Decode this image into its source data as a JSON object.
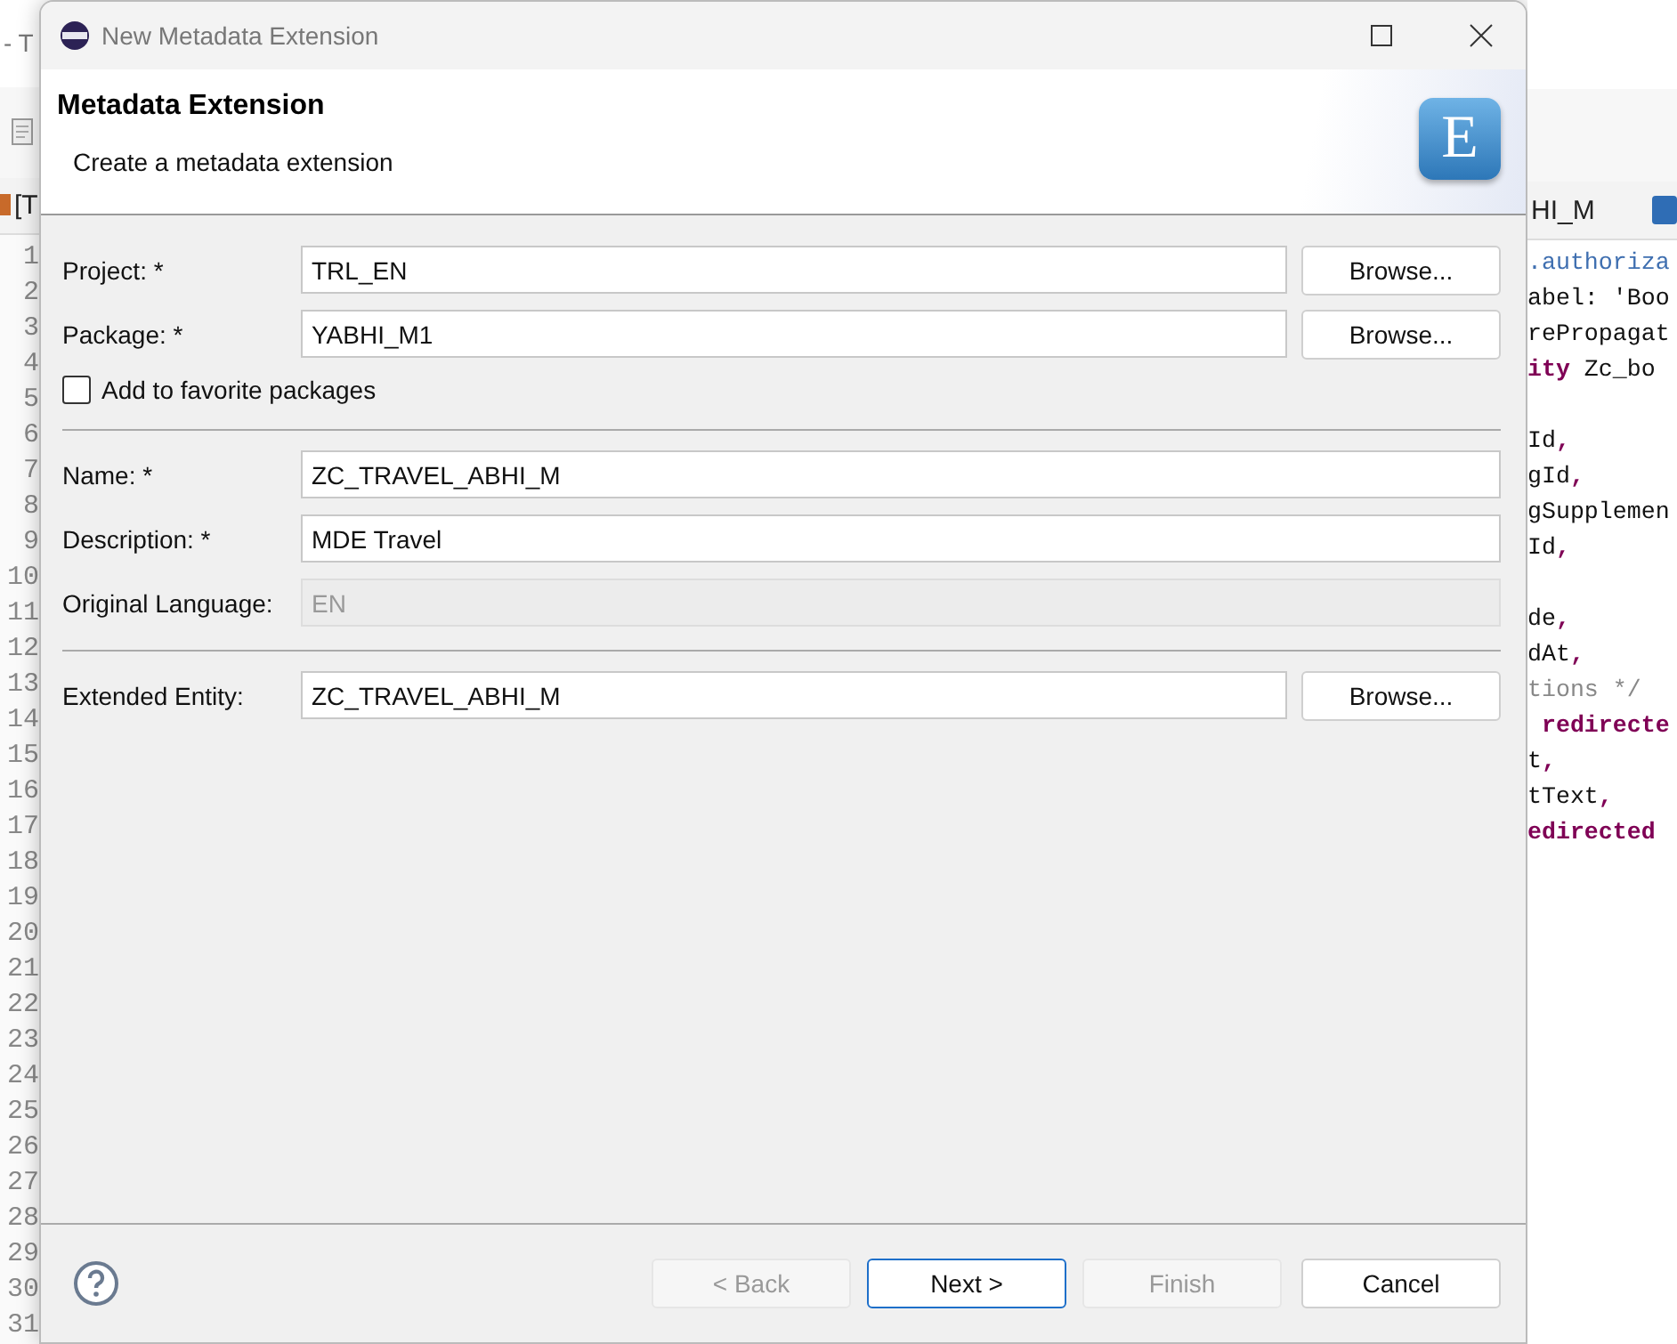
{
  "ide": {
    "title_fragment": "- T",
    "left_tab": "[T",
    "right_tab": "HI_M",
    "line_numbers": [
      "1",
      "2",
      "3",
      "4",
      "5",
      "6",
      "7",
      "8",
      "9",
      "10",
      "11",
      "12",
      "13",
      "14",
      "15",
      "16",
      "17",
      "18",
      "19",
      "20",
      "21",
      "22",
      "23",
      "24",
      "25",
      "26",
      "27",
      "28",
      "29",
      "30",
      "31"
    ],
    "code_lines": [
      {
        "kind": "code",
        "segments": [
          {
            "text": ".authoriza",
            "kind": "annotation"
          }
        ]
      },
      {
        "kind": "code",
        "segments": [
          {
            "text": "abel: 'Boo",
            "kind": "plain"
          }
        ]
      },
      {
        "kind": "code",
        "segments": [
          {
            "text": "rePropagat",
            "kind": "plain"
          }
        ]
      },
      {
        "kind": "code",
        "segments": [
          {
            "text": "ity",
            "kind": "keyword"
          },
          {
            "text": " Zc_bo",
            "kind": "plain"
          }
        ]
      },
      {
        "kind": "blank"
      },
      {
        "kind": "code",
        "segments": [
          {
            "text": "Id",
            "kind": "plain"
          },
          {
            "text": ",",
            "kind": "keyword"
          }
        ]
      },
      {
        "kind": "code",
        "segments": [
          {
            "text": "gId",
            "kind": "plain"
          },
          {
            "text": ",",
            "kind": "keyword"
          }
        ]
      },
      {
        "kind": "code",
        "segments": [
          {
            "text": "gSupplemen",
            "kind": "plain"
          }
        ]
      },
      {
        "kind": "code",
        "segments": [
          {
            "text": "Id",
            "kind": "plain"
          },
          {
            "text": ",",
            "kind": "keyword"
          }
        ]
      },
      {
        "kind": "blank"
      },
      {
        "kind": "code",
        "segments": [
          {
            "text": "de",
            "kind": "plain"
          },
          {
            "text": ",",
            "kind": "keyword"
          }
        ]
      },
      {
        "kind": "code",
        "segments": [
          {
            "text": "dAt",
            "kind": "plain"
          },
          {
            "text": ",",
            "kind": "keyword"
          }
        ]
      },
      {
        "kind": "code",
        "segments": [
          {
            "text": "tions */",
            "kind": "comment"
          }
        ]
      },
      {
        "kind": "code",
        "segments": [
          {
            "text": " redirecte",
            "kind": "keyword"
          }
        ]
      },
      {
        "kind": "code",
        "segments": [
          {
            "text": "t",
            "kind": "plain"
          },
          {
            "text": ",",
            "kind": "keyword"
          }
        ]
      },
      {
        "kind": "code",
        "segments": [
          {
            "text": "tText",
            "kind": "plain"
          },
          {
            "text": ",",
            "kind": "keyword"
          }
        ]
      },
      {
        "kind": "code",
        "segments": [
          {
            "text": "edirected",
            "kind": "keyword"
          }
        ]
      }
    ]
  },
  "dialog": {
    "title": "New Metadata Extension",
    "header": {
      "title": "Metadata Extension",
      "subtitle": "Create a metadata extension",
      "logo_letter": "E"
    },
    "sections": [
      {
        "rows": [
          {
            "kind": "field",
            "label": "Project: *",
            "value": "TRL_EN",
            "disabled": false,
            "browse": "Browse..."
          },
          {
            "kind": "field",
            "label": "Package: *",
            "value": "YABHI_M1",
            "disabled": false,
            "browse": "Browse..."
          },
          {
            "kind": "checkbox",
            "label": "Add to favorite packages",
            "checked": false
          }
        ]
      },
      {
        "rows": [
          {
            "kind": "field",
            "label": "Name: *",
            "value": "ZC_TRAVEL_ABHI_M",
            "disabled": false
          },
          {
            "kind": "field",
            "label": "Description: *",
            "value": "MDE Travel",
            "disabled": false
          },
          {
            "kind": "field",
            "label": "Original Language:",
            "value": "EN",
            "disabled": true
          }
        ]
      },
      {
        "rows": [
          {
            "kind": "field",
            "label": "Extended Entity:",
            "value": "ZC_TRAVEL_ABHI_M",
            "disabled": false,
            "browse": "Browse..."
          }
        ]
      }
    ],
    "buttons": [
      {
        "label": "< Back",
        "disabled": true,
        "default": false
      },
      {
        "label": "Next >",
        "disabled": false,
        "default": true
      },
      {
        "label": "Finish",
        "disabled": true,
        "default": false
      },
      {
        "label": "Cancel",
        "disabled": false,
        "default": false
      }
    ]
  }
}
